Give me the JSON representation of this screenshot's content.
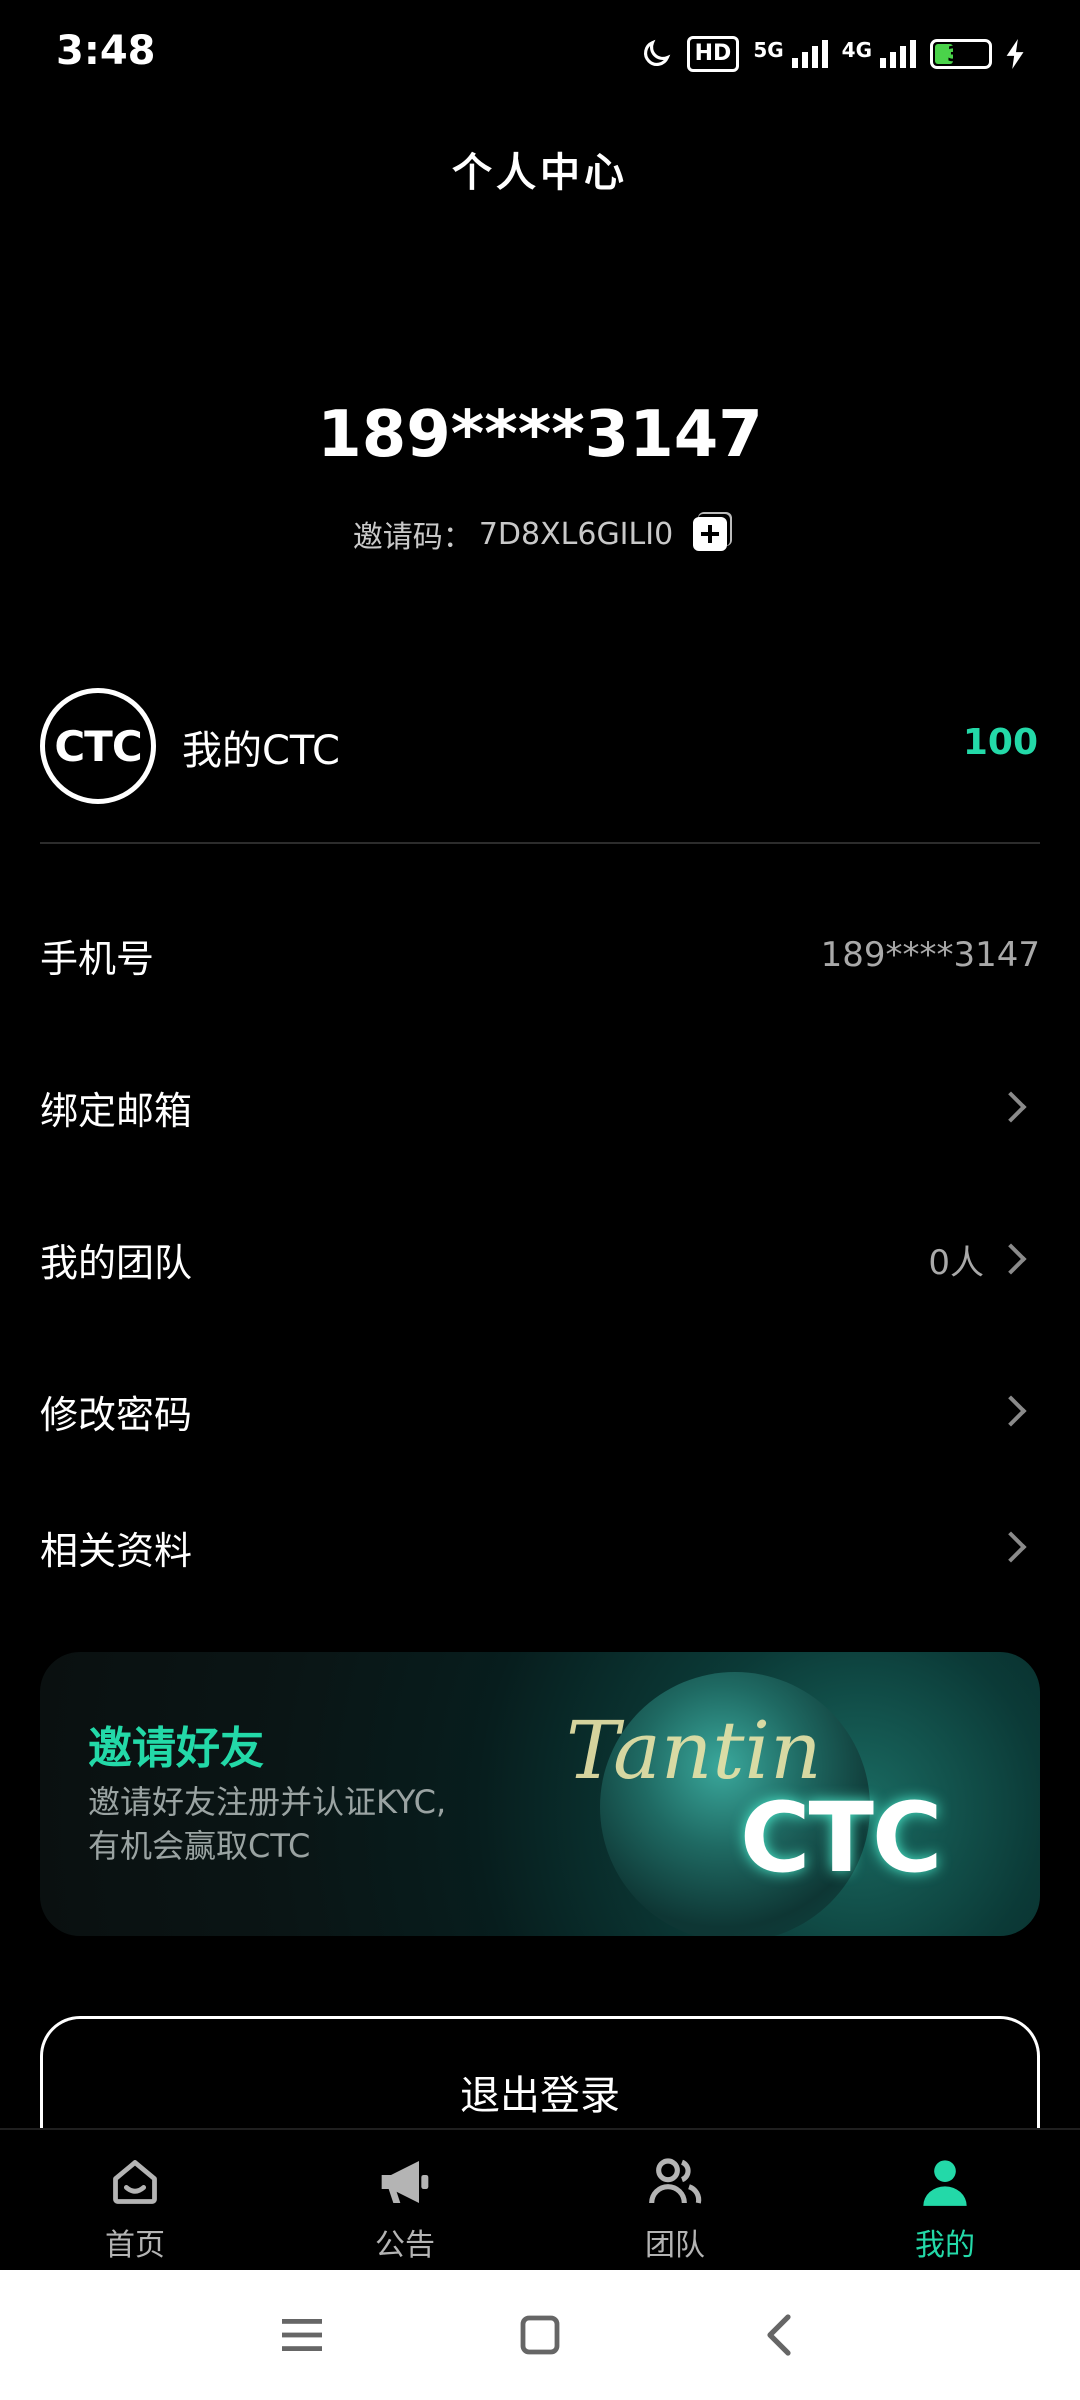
{
  "status_bar": {
    "time": "3:48",
    "hd_label": "HD",
    "net1": "5G",
    "net2": "4G",
    "battery": "32"
  },
  "header": {
    "title": "个人中心",
    "phone": "189****3147",
    "invite_label": "邀请码：",
    "invite_code": "7D8XL6GILI0"
  },
  "ctc": {
    "logo_text": "CTC",
    "label": "我的CTC",
    "value": "100"
  },
  "rows": [
    {
      "label": "手机号",
      "value": "189****3147"
    },
    {
      "label": "绑定邮箱",
      "value": ""
    },
    {
      "label": "我的团队",
      "value": "0人"
    },
    {
      "label": "修改密码",
      "value": ""
    },
    {
      "label": "相关资料",
      "value": ""
    }
  ],
  "banner": {
    "title": "邀请好友",
    "desc_line1": "邀请好友注册并认证KYC,",
    "desc_line2": "有机会赢取CTC",
    "brand_script": "Tantin",
    "brand_logo": "CTC"
  },
  "logout_label": "退出登录",
  "nav": [
    {
      "label": "首页",
      "icon": "home-icon"
    },
    {
      "label": "公告",
      "icon": "megaphone-icon"
    },
    {
      "label": "团队",
      "icon": "team-icon"
    },
    {
      "label": "我的",
      "icon": "person-icon"
    }
  ],
  "colors": {
    "accent": "#23d9a8",
    "background": "#000000"
  }
}
